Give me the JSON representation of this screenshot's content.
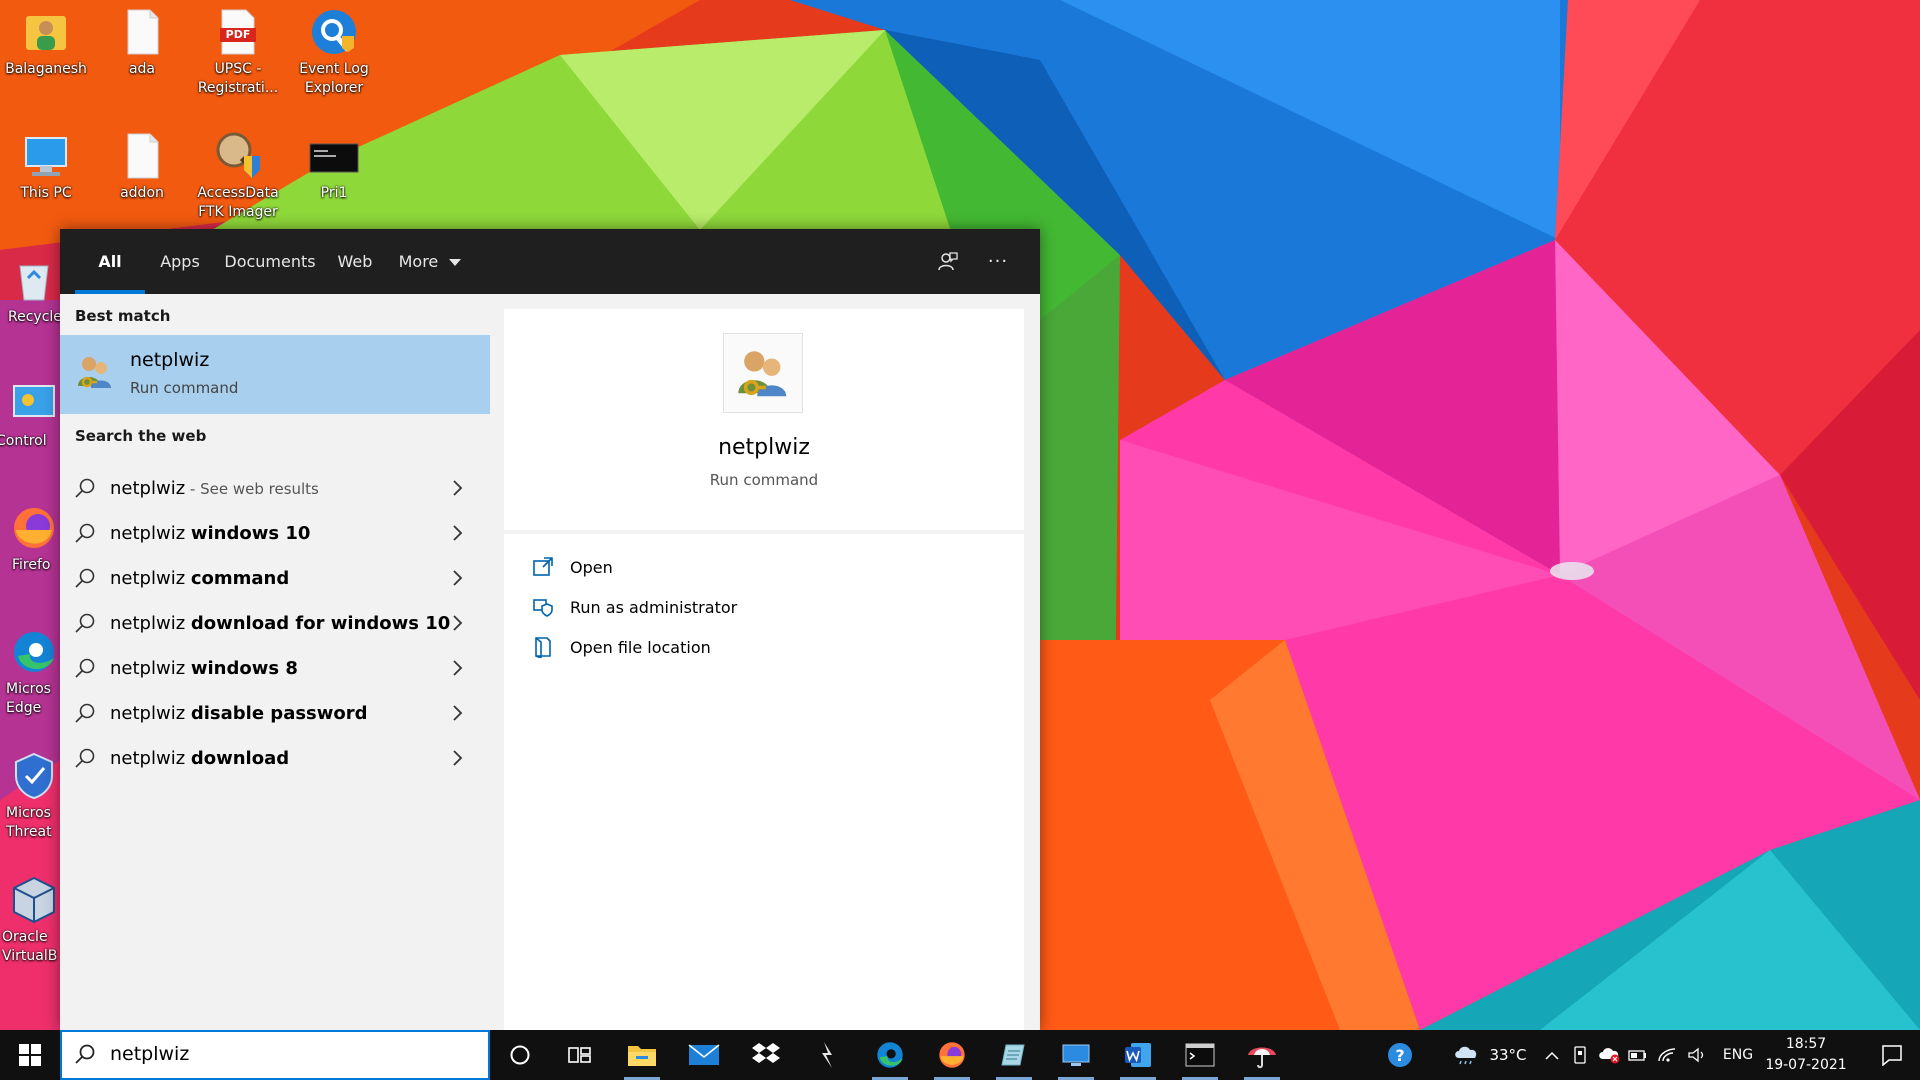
{
  "desktop": {
    "icons": [
      {
        "label": "Balaganesh"
      },
      {
        "label": "ada"
      },
      {
        "label": "UPSC - Registrati...",
        "badge": "PDF"
      },
      {
        "label": "Event Log Explorer"
      },
      {
        "label": "This PC"
      },
      {
        "label": "addon"
      },
      {
        "label": "AccessData FTK Imager"
      },
      {
        "label": "Pri1"
      },
      {
        "label": "Recycle"
      },
      {
        "label": "Control"
      },
      {
        "label": "Firefo"
      },
      {
        "label": "Micros Edge"
      },
      {
        "label": "Micros Threat"
      },
      {
        "label": "Oracle VirtualB"
      }
    ]
  },
  "search_panel": {
    "tabs": [
      {
        "label": "All",
        "active": true
      },
      {
        "label": "Apps"
      },
      {
        "label": "Documents"
      },
      {
        "label": "Web"
      },
      {
        "label": "More"
      }
    ],
    "header_icons": [
      "feedback-icon",
      "more-options-icon"
    ],
    "more_options_glyph": "···",
    "best_match": {
      "title": "Best match",
      "name": "netplwiz",
      "type": "Run command"
    },
    "web": {
      "title": "Search the web",
      "results": [
        {
          "prefix": "netplwiz",
          "bold": "",
          "hint": " - See web results"
        },
        {
          "prefix": "netplwiz ",
          "bold": "windows 10",
          "hint": ""
        },
        {
          "prefix": "netplwiz ",
          "bold": "command",
          "hint": ""
        },
        {
          "prefix": "netplwiz ",
          "bold": "download for windows 10",
          "hint": ""
        },
        {
          "prefix": "netplwiz ",
          "bold": "windows 8",
          "hint": ""
        },
        {
          "prefix": "netplwiz ",
          "bold": "disable password",
          "hint": ""
        },
        {
          "prefix": "netplwiz ",
          "bold": "download",
          "hint": ""
        }
      ]
    },
    "preview": {
      "name": "netplwiz",
      "type": "Run command",
      "actions": [
        {
          "label": "Open",
          "icon": "open-icon"
        },
        {
          "label": "Run as administrator",
          "icon": "shield-admin-icon"
        },
        {
          "label": "Open file location",
          "icon": "file-location-icon"
        }
      ]
    }
  },
  "taskbar": {
    "search_value": "netplwiz",
    "apps": [
      "cortana",
      "task-view",
      "file-explorer",
      "mail",
      "dropbox",
      "arrow-app",
      "edge",
      "firefox",
      "notepad",
      "display",
      "word",
      "terminal",
      "umbrella-app"
    ],
    "weather": "33°C",
    "language": "ENG",
    "time": "18:57",
    "date": "19-07-2021",
    "colors": {
      "accent": "#0078d7",
      "best_match_highlight": "#a8cfee",
      "taskbar": "#101010"
    }
  }
}
